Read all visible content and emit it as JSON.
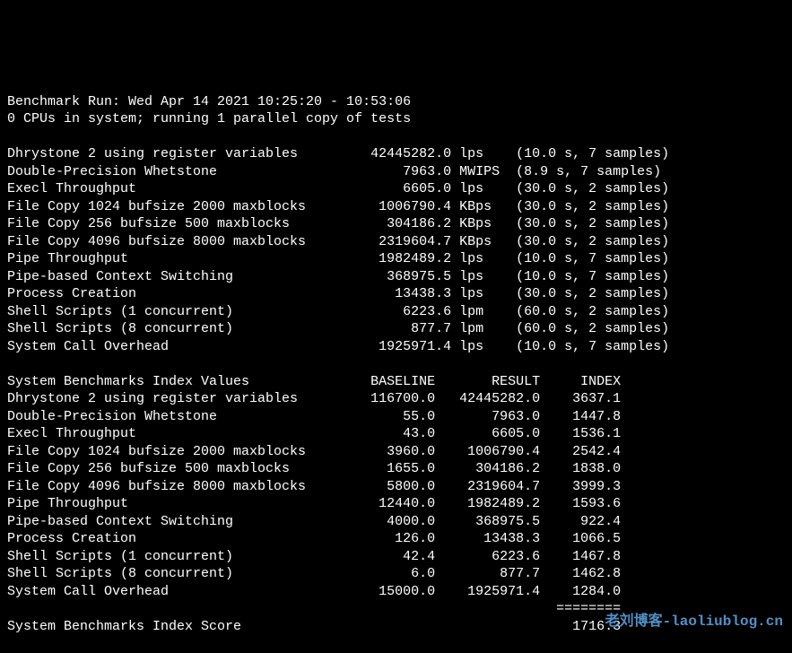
{
  "header": {
    "run_line_prefix": "Benchmark Run: ",
    "run_time": "Wed Apr 14 2021 10:25:20 - 10:53:06",
    "cpu_line": "0 CPUs in system; running 1 parallel copy of tests"
  },
  "rates": [
    {
      "name": "Dhrystone 2 using register variables",
      "value": "42445282.0",
      "unit": "lps",
      "timing": "(10.0 s, 7 samples)"
    },
    {
      "name": "Double-Precision Whetstone",
      "value": "7963.0",
      "unit": "MWIPS",
      "timing": "(8.9 s, 7 samples)"
    },
    {
      "name": "Execl Throughput",
      "value": "6605.0",
      "unit": "lps",
      "timing": "(30.0 s, 2 samples)"
    },
    {
      "name": "File Copy 1024 bufsize 2000 maxblocks",
      "value": "1006790.4",
      "unit": "KBps",
      "timing": "(30.0 s, 2 samples)"
    },
    {
      "name": "File Copy 256 bufsize 500 maxblocks",
      "value": "304186.2",
      "unit": "KBps",
      "timing": "(30.0 s, 2 samples)"
    },
    {
      "name": "File Copy 4096 bufsize 8000 maxblocks",
      "value": "2319604.7",
      "unit": "KBps",
      "timing": "(30.0 s, 2 samples)"
    },
    {
      "name": "Pipe Throughput",
      "value": "1982489.2",
      "unit": "lps",
      "timing": "(10.0 s, 7 samples)"
    },
    {
      "name": "Pipe-based Context Switching",
      "value": "368975.5",
      "unit": "lps",
      "timing": "(10.0 s, 7 samples)"
    },
    {
      "name": "Process Creation",
      "value": "13438.3",
      "unit": "lps",
      "timing": "(30.0 s, 2 samples)"
    },
    {
      "name": "Shell Scripts (1 concurrent)",
      "value": "6223.6",
      "unit": "lpm",
      "timing": "(60.0 s, 2 samples)"
    },
    {
      "name": "Shell Scripts (8 concurrent)",
      "value": "877.7",
      "unit": "lpm",
      "timing": "(60.0 s, 2 samples)"
    },
    {
      "name": "System Call Overhead",
      "value": "1925971.4",
      "unit": "lps",
      "timing": "(10.0 s, 7 samples)"
    }
  ],
  "index_header": {
    "title": "System Benchmarks Index Values",
    "col_baseline": "BASELINE",
    "col_result": "RESULT",
    "col_index": "INDEX"
  },
  "indexes": [
    {
      "name": "Dhrystone 2 using register variables",
      "baseline": "116700.0",
      "result": "42445282.0",
      "index": "3637.1"
    },
    {
      "name": "Double-Precision Whetstone",
      "baseline": "55.0",
      "result": "7963.0",
      "index": "1447.8"
    },
    {
      "name": "Execl Throughput",
      "baseline": "43.0",
      "result": "6605.0",
      "index": "1536.1"
    },
    {
      "name": "File Copy 1024 bufsize 2000 maxblocks",
      "baseline": "3960.0",
      "result": "1006790.4",
      "index": "2542.4"
    },
    {
      "name": "File Copy 256 bufsize 500 maxblocks",
      "baseline": "1655.0",
      "result": "304186.2",
      "index": "1838.0"
    },
    {
      "name": "File Copy 4096 bufsize 8000 maxblocks",
      "baseline": "5800.0",
      "result": "2319604.7",
      "index": "3999.3"
    },
    {
      "name": "Pipe Throughput",
      "baseline": "12440.0",
      "result": "1982489.2",
      "index": "1593.6"
    },
    {
      "name": "Pipe-based Context Switching",
      "baseline": "4000.0",
      "result": "368975.5",
      "index": "922.4"
    },
    {
      "name": "Process Creation",
      "baseline": "126.0",
      "result": "13438.3",
      "index": "1066.5"
    },
    {
      "name": "Shell Scripts (1 concurrent)",
      "baseline": "42.4",
      "result": "6223.6",
      "index": "1467.8"
    },
    {
      "name": "Shell Scripts (8 concurrent)",
      "baseline": "6.0",
      "result": "877.7",
      "index": "1462.8"
    },
    {
      "name": "System Call Overhead",
      "baseline": "15000.0",
      "result": "1925971.4",
      "index": "1284.0"
    }
  ],
  "score": {
    "label": "System Benchmarks Index Score",
    "value": "1716.3"
  },
  "watermark": "老刘博客-laoliublog.cn"
}
